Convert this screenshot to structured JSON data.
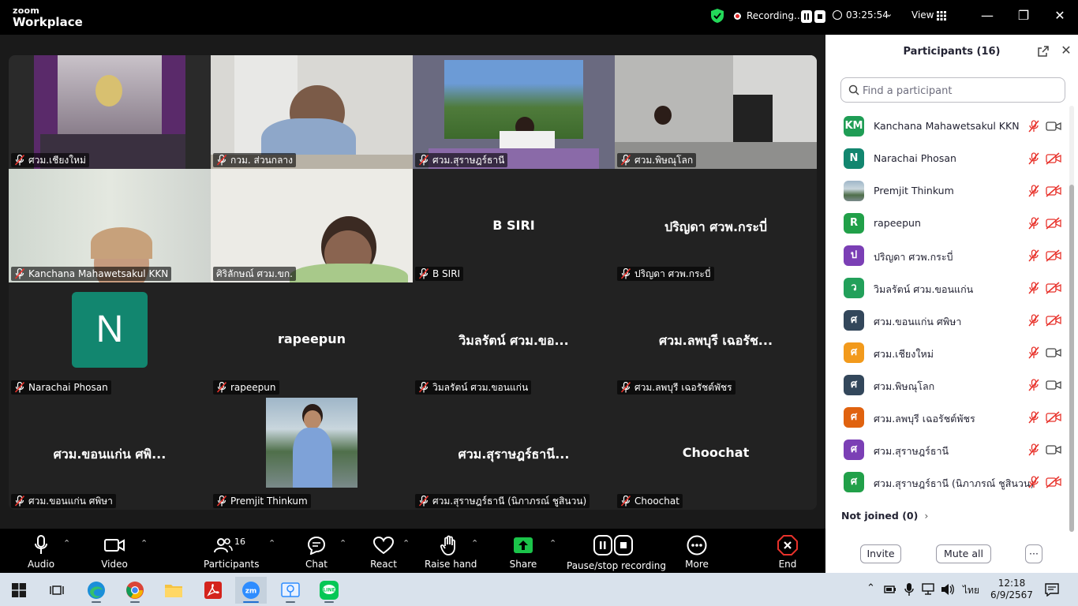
{
  "app": {
    "brand_top": "zoom",
    "brand_name": "Workplace",
    "recording_label": "Recording...",
    "elapsed": "03:25:54",
    "view_label": "View"
  },
  "tiles": [
    {
      "name": "ศวม.เชียงใหม่",
      "big": "",
      "video": true
    },
    {
      "name": "กวม. ส่วนกลาง",
      "big": "",
      "video": true,
      "active": true
    },
    {
      "name": "ศวม.สุราษฎร์ธานี",
      "big": "",
      "video": true
    },
    {
      "name": "ศวม.พิษณุโลก",
      "big": "",
      "video": true
    },
    {
      "name": "Kanchana Mahawetsakul KKN",
      "big": "",
      "video": true
    },
    {
      "name": "ศิริลักษณ์ ศวม.ขก.",
      "big": "",
      "video": true,
      "unmuted": true
    },
    {
      "name": "B SIRI",
      "big": "B SIRI"
    },
    {
      "name": "ปริญดา ศวพ.กระบี่",
      "big": "ปริญดา ศวพ.กระบี่"
    },
    {
      "name": "Narachai Phosan",
      "big": "",
      "avatar_letter": "N"
    },
    {
      "name": "rapeepun",
      "big": "rapeepun"
    },
    {
      "name": "วิมลรัตน์ ศวม.ขอนแก่น",
      "big": "วิมลรัตน์ ศวม.ขอ..."
    },
    {
      "name": "ศวม.ลพบุรี เฉอรัชต์พัชร",
      "big": "ศวม.ลพบุรี เฉอรัช..."
    },
    {
      "name": "ศวม.ขอนแก่น ศพิษา",
      "big": "ศวม.ขอนแก่น ศพิ..."
    },
    {
      "name": "Premjit Thinkum",
      "big": "",
      "photo": true
    },
    {
      "name": "ศวม.สุราษฎร์ธานี (นิภาภรณ์ ชูสินวน)",
      "big": "ศวม.สุราษฎร์ธานี..."
    },
    {
      "name": "Choochat",
      "big": "Choochat"
    }
  ],
  "toolbar": {
    "audio": "Audio",
    "video": "Video",
    "participants": "Participants",
    "participants_count": "16",
    "chat": "Chat",
    "react": "React",
    "raise_hand": "Raise hand",
    "share": "Share",
    "pause_stop": "Pause/stop recording",
    "more": "More",
    "end": "End"
  },
  "panel": {
    "title": "Participants (16)",
    "search_placeholder": "Find a participant",
    "participants": [
      {
        "initials": "KM",
        "color": "#1f9d55",
        "name": "Kanchana Mahawetsakul KKN",
        "video_on": true
      },
      {
        "initials": "N",
        "color": "#12866f",
        "name": "Narachai Phosan",
        "video_on": false
      },
      {
        "initials": "",
        "color": "#7a8a9a",
        "name": "Premjit Thinkum",
        "video_on": false,
        "photo": true
      },
      {
        "initials": "R",
        "color": "#21a049",
        "name": "rapeepun",
        "video_on": false
      },
      {
        "initials": "ป",
        "color": "#7b3fb5",
        "name": "ปริญดา ศวพ.กระบี่",
        "video_on": false
      },
      {
        "initials": "ว",
        "color": "#22a05a",
        "name": "วิมลรัตน์ ศวม.ขอนแก่น",
        "video_on": false
      },
      {
        "initials": "ศ",
        "color": "#33475b",
        "name": "ศวม.ขอนแก่น ศพิษา",
        "video_on": false
      },
      {
        "initials": "ศ",
        "color": "#f29a1c",
        "name": "ศวม.เชียงใหม่",
        "video_on": true
      },
      {
        "initials": "ศ",
        "color": "#33475b",
        "name": "ศวม.พิษณุโลก",
        "video_on": true
      },
      {
        "initials": "ศ",
        "color": "#e0620f",
        "name": "ศวม.ลพบุรี เฉอรัชต์พัชร",
        "video_on": false
      },
      {
        "initials": "ศ",
        "color": "#7b3fb5",
        "name": "ศวม.สุราษฎร์ธานี",
        "video_on": true
      },
      {
        "initials": "ศ",
        "color": "#21a049",
        "name": "ศวม.สุราษฎร์ธานี (นิภาภรณ์ ชูสินวน)",
        "video_on": false
      }
    ],
    "not_joined": "Not joined (0)",
    "invite": "Invite",
    "mute_all": "Mute all",
    "more": "···"
  },
  "taskbar": {
    "time": "12:18",
    "date": "6/9/2567",
    "lang": "ไทย"
  }
}
